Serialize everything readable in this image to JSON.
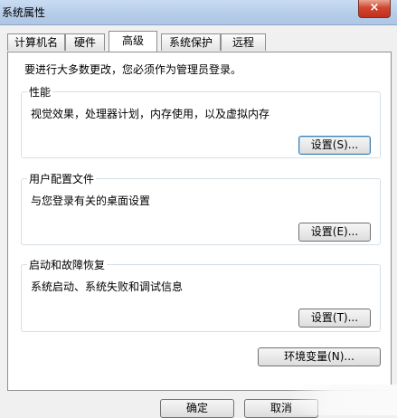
{
  "window": {
    "title": "系统属性",
    "close_label": "×"
  },
  "tabs": [
    {
      "label": "计算机名"
    },
    {
      "label": "硬件"
    },
    {
      "label": "高级"
    },
    {
      "label": "系统保护"
    },
    {
      "label": "远程"
    }
  ],
  "active_tab": "高级",
  "intro_text": "要进行大多数更改，您必须作为管理员登录。",
  "groups": {
    "performance": {
      "title": "性能",
      "description": "视觉效果，处理器计划，内存使用，以及虚拟内存",
      "button": "设置(S)..."
    },
    "profiles": {
      "title": "用户配置文件",
      "description": "与您登录有关的桌面设置",
      "button": "设置(E)..."
    },
    "startup": {
      "title": "启动和故障恢复",
      "description": "系统启动、系统失败和调试信息",
      "button": "设置(T)..."
    }
  },
  "env_button": "环境变量(N)...",
  "footer": {
    "ok": "确定",
    "cancel": "取消"
  }
}
